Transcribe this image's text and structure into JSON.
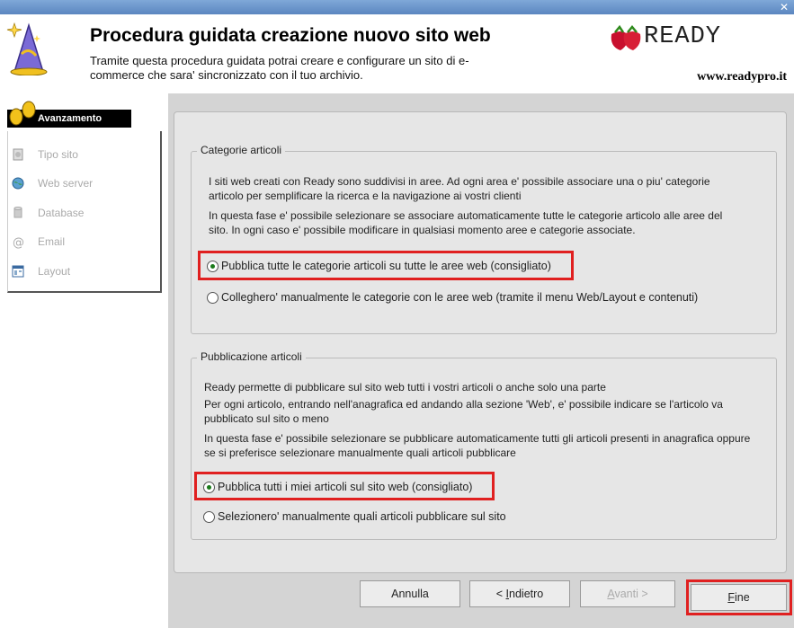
{
  "window": {
    "close_glyph": "✕"
  },
  "header": {
    "title": "Procedura guidata creazione nuovo sito web",
    "description": "Tramite questa procedura guidata potrai creare e configurare un sito di e-commerce che sara' sincronizzato con il tuo archivio.",
    "logo_text": "READY",
    "site_url": "www.readypro.it"
  },
  "sidebar": {
    "heading": "Avanzamento",
    "items": [
      {
        "label": "Tipo sito",
        "icon": "site-type-icon"
      },
      {
        "label": "Web server",
        "icon": "globe-icon"
      },
      {
        "label": "Database",
        "icon": "database-icon"
      },
      {
        "label": "Email",
        "icon": "at-sign-icon"
      },
      {
        "label": "Layout",
        "icon": "layout-icon"
      }
    ]
  },
  "categorie": {
    "legend": "Categorie articoli",
    "p1": "I siti web creati con Ready sono suddivisi in aree. Ad ogni area e' possibile associare una o piu' categorie articolo per semplificare la ricerca e la navigazione ai vostri clienti",
    "p2": "In questa fase e' possibile selezionare se associare automaticamente tutte le categorie articolo alle aree del sito. In ogni caso e' possibile modificare in qualsiasi momento aree e categorie associate.",
    "option1": "Pubblica tutte le categorie articoli su tutte le aree web (consigliato)",
    "option2": "Colleghero' manualmente le categorie con le aree web (tramite il menu Web/Layout e contenuti)",
    "selected": 1
  },
  "pubblicazione": {
    "legend": "Pubblicazione articoli",
    "p1": "Ready permette di pubblicare sul sito web tutti i vostri articoli o anche solo una parte",
    "p2": "Per ogni articolo, entrando nell'anagrafica ed andando alla sezione 'Web', e' possibile indicare se l'articolo va pubblicato sul sito o meno",
    "p3": "In questa fase e' possibile selezionare se pubblicare automaticamente tutti gli articoli presenti in anagrafica oppure se si preferisce selezionare manualmente quali articoli pubblicare",
    "option1": "Pubblica tutti i miei articoli sul sito web (consigliato)",
    "option2": "Selezionero' manualmente quali articoli pubblicare sul sito",
    "selected": 1
  },
  "buttons": {
    "cancel": "Annulla",
    "back_prefix": "< ",
    "back_mnemonic": "I",
    "back_rest": "ndietro",
    "next_mnemonic": "A",
    "next_rest": "vanti >",
    "finish_mnemonic": "F",
    "finish_rest": "ine"
  },
  "colors": {
    "highlight": "#e02020",
    "radio_dot": "#1a7a1a",
    "brand_red": "#c8102e"
  }
}
